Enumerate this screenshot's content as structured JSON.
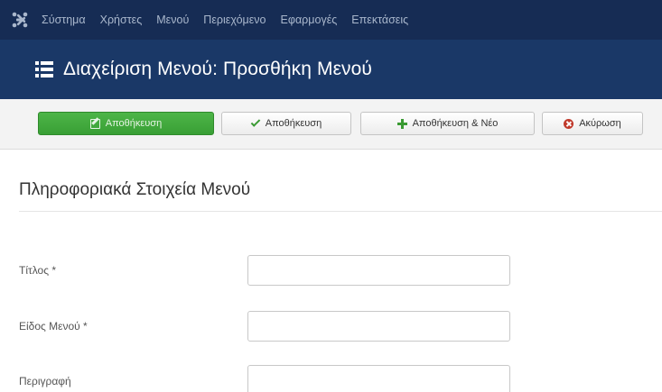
{
  "topbar": {
    "logo_icon": "joomla-logo-icon",
    "menu": [
      "Σύστημα",
      "Χρήστες",
      "Μενού",
      "Περιεχόμενο",
      "Εφαρμογές",
      "Επεκτάσεις"
    ]
  },
  "header": {
    "icon": "list-icon",
    "title": "Διαχείριση Μενού: Προσθήκη Μενού"
  },
  "toolbar": {
    "save_label": "Αποθήκευση",
    "save_icon": "edit-icon",
    "save_close_label": "Αποθήκευση",
    "save_close_icon": "check-icon",
    "save_new_label": "Αποθήκευση & Νέο",
    "save_new_icon": "plus-icon",
    "cancel_label": "Ακύρωση",
    "cancel_icon": "cancel-icon"
  },
  "content": {
    "section_title": "Πληροφοριακά Στοιχεία Μενού",
    "fields": [
      {
        "label": "Τίτλος *",
        "value": ""
      },
      {
        "label": "Είδος Μενού *",
        "value": ""
      },
      {
        "label": "Περιγραφή",
        "value": ""
      }
    ]
  },
  "colors": {
    "topbar_bg": "#162c54",
    "header_bg": "#1a3867",
    "save_green": "#43aa3f",
    "cancel_red": "#c0392b"
  }
}
